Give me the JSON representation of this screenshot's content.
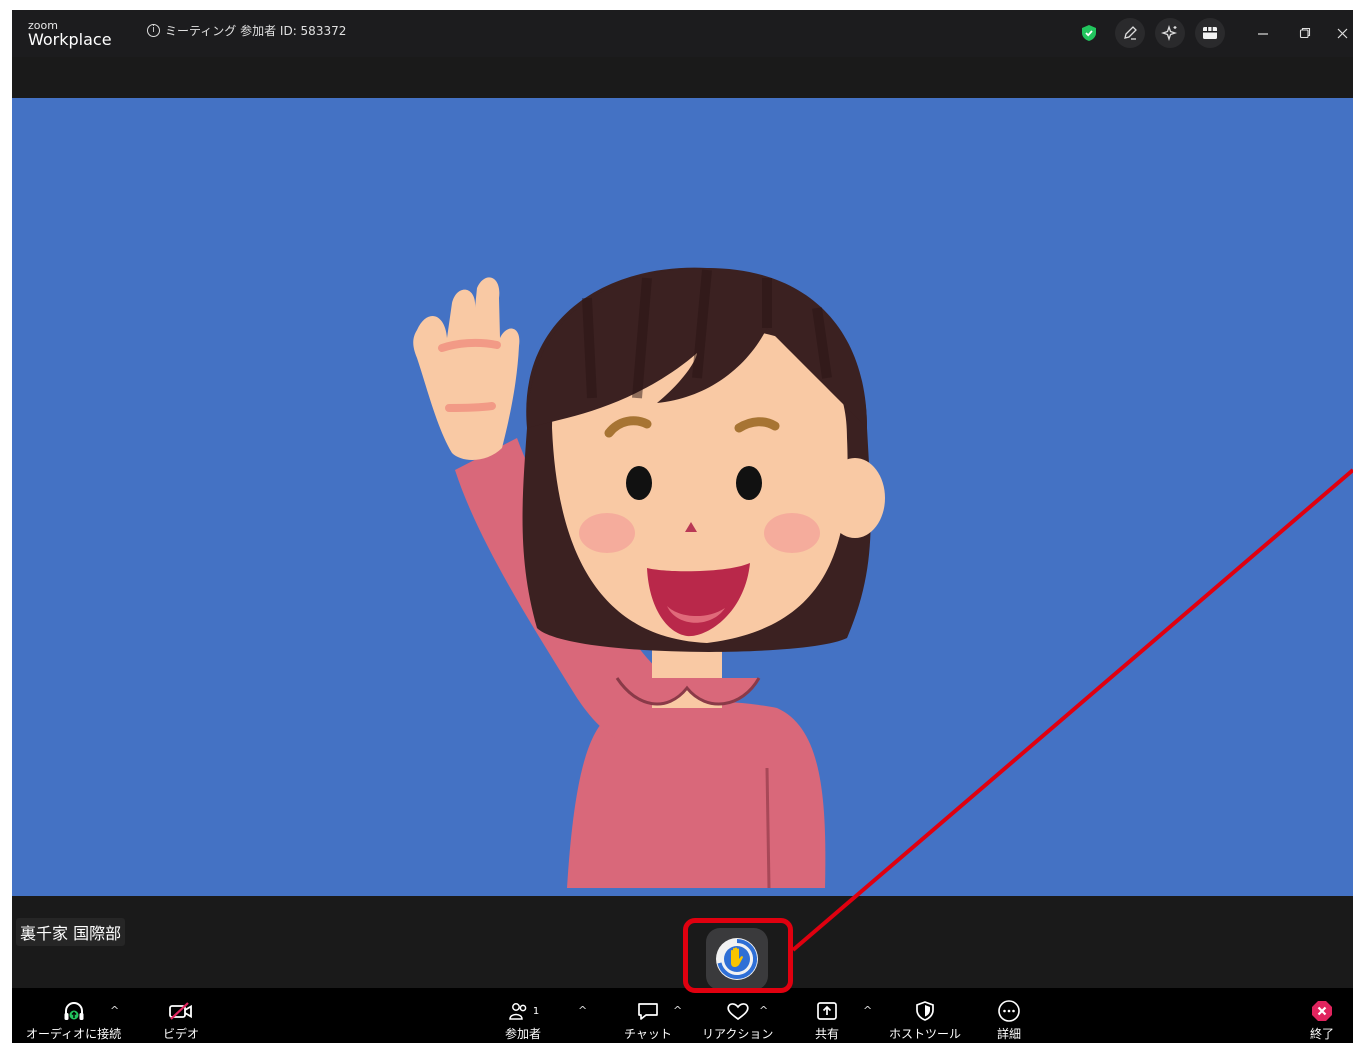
{
  "app": {
    "logo_top": "zoom",
    "logo_bottom": "Workplace"
  },
  "meeting": {
    "info_icon": "info-icon",
    "info_text": "ミーティング 参加者 ID: 583372"
  },
  "titlebar_icons": [
    "security-shield-icon",
    "annotate-pen-icon",
    "ai-sparkle-icon",
    "apps-icon",
    "minimize-icon",
    "restore-icon",
    "close-icon"
  ],
  "participant": {
    "name": "裏千家 国際部"
  },
  "raise_hand": {
    "icon": "raise-hand-icon"
  },
  "toolbar": {
    "audio": "オーディオに接続",
    "video": "ビデオ",
    "participants": "参加者",
    "participants_count": "1",
    "chat": "チャット",
    "reactions": "リアクション",
    "share": "共有",
    "host_tools": "ホストツール",
    "more": "詳細",
    "end": "終了",
    "caret": "^"
  },
  "colors": {
    "video_bg": "#4472c4",
    "highlight": "#e0000f",
    "shield": "#22c55e",
    "end": "#e0245e"
  }
}
